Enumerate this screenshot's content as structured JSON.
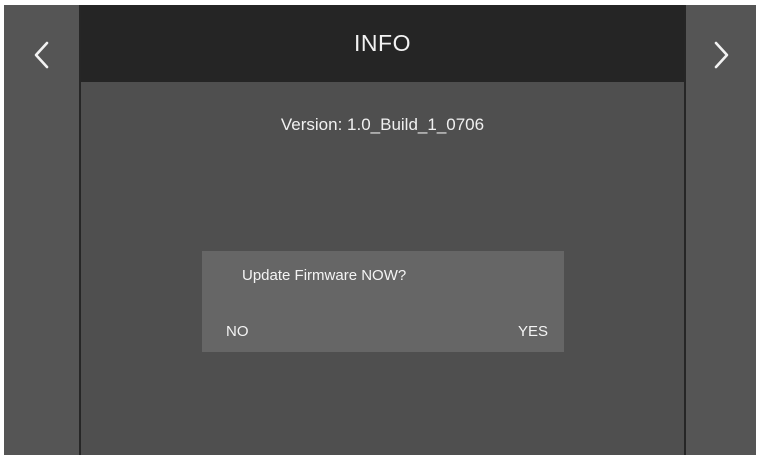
{
  "header": {
    "title": "INFO"
  },
  "nav": {
    "prev_icon": "chevron-left-icon",
    "next_icon": "chevron-right-icon"
  },
  "info": {
    "version_text": "Version: 1.0_Build_1_0706"
  },
  "dialog": {
    "question": "Update Firmware NOW?",
    "no_label": "NO",
    "yes_label": "YES"
  },
  "colors": {
    "screen_bg": "#515151",
    "title_bar_bg": "#252525",
    "dialog_bg": "#666666",
    "text": "#f2f2f2"
  }
}
